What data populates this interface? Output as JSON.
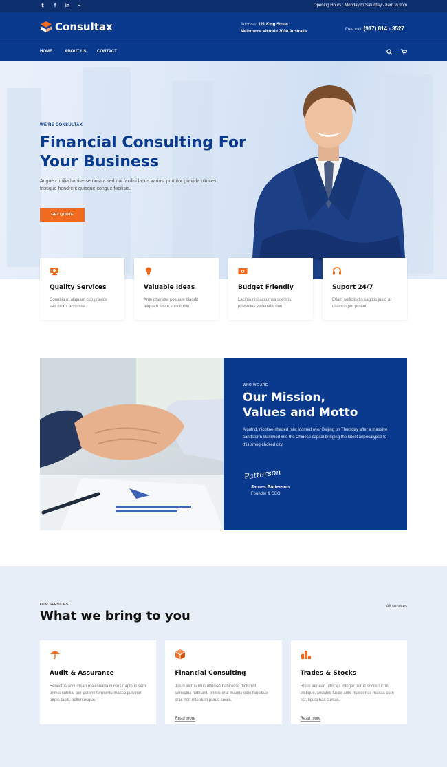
{
  "topbar": {
    "social": [
      "twitter-icon",
      "facebook-icon",
      "linkedin-icon",
      "rss-icon"
    ],
    "social_glyphs": [
      "𝕥",
      "f",
      "in",
      "⌁"
    ],
    "hours": "Opening Hours : Monday to Saturday - 8am to 9pm"
  },
  "header": {
    "brand": "Consultax",
    "address_label": "Address:",
    "address_line1": "121 King Street",
    "address_line2": "Melbourne Victoria 3000 Australia",
    "phone_label": "Free call:",
    "phone": "(917) 814 - 3527"
  },
  "nav": {
    "items": [
      "HOME",
      "ABOUT US",
      "CONTACT"
    ],
    "icons": [
      "search-icon",
      "cart-icon"
    ]
  },
  "hero": {
    "eyebrow": "WE'RE CONSULTAX",
    "title": "Financial Consulting For Your Business",
    "description": "Augue cubilia habitasse nostra sed dui facilisi lacus varius, porttitor gravida ultrices tristique hendrerit quisque congue facilisis.",
    "cta": "GET QUOTE"
  },
  "features": [
    {
      "icon": "monitor-icon",
      "title": "Quality Services",
      "text": "Conubia ut aliquam cub gravida sed morbi accumsa."
    },
    {
      "icon": "lightbulb-icon",
      "title": "Valuable Ideas",
      "text": "Ante pharetra posuere blandit aliquam fusce sollicitudin."
    },
    {
      "icon": "money-icon",
      "title": "Budget Friendly",
      "text": "Lacinia nisl accumsa sceleris phasellus venenatis don."
    },
    {
      "icon": "headset-icon",
      "title": "Suport 24/7",
      "text": "Etiam sollicitudin sagittis justo at ullamcorper potenti."
    }
  ],
  "mission": {
    "eyebrow": "WHO WE ARE",
    "title_line1": "Our Mission,",
    "title_line2": "Values and Motto",
    "text": "A putrid, nicotine-shaded mist loomed over Beijing on Thursday after a massive sandstorm slammed into the Chinese capital bringing the latest airpocalypse to this smog-choked city.",
    "signature": "Patterson",
    "name": "James Patterson",
    "role": "Founder & CEO"
  },
  "services": {
    "eyebrow": "OUR SERVICES",
    "title": "What we bring to you",
    "all_link": "All services",
    "items": [
      {
        "icon": "umbrella-icon",
        "title": "Audit & Assurance",
        "text": "Senectus accumsan malesuada cursus dapibus sem primis cubilia, per potenti fermentu massa pulvinar turpis taciti, pellentesque.",
        "link": ""
      },
      {
        "icon": "box-icon",
        "title": "Financial Consulting",
        "text": "Justo luctus mus ultricies habitasse dictumst senectus habitant, primis erat mauris odio faucibus cras non interdum purus sociis.",
        "link": "Read more"
      },
      {
        "icon": "bar-chart-icon",
        "title": "Trades & Stocks",
        "text": "Risus aenean ultricies integer purus sociis luctus tristique, sodales fusce ante maecenas massa cum est, ligula hac cursus.",
        "link": "Read more"
      }
    ]
  },
  "colors": {
    "primary": "#0a3a8e",
    "topbar": "#0e2f6e",
    "accent": "#f06a1f",
    "services_bg": "#e8eef7"
  }
}
